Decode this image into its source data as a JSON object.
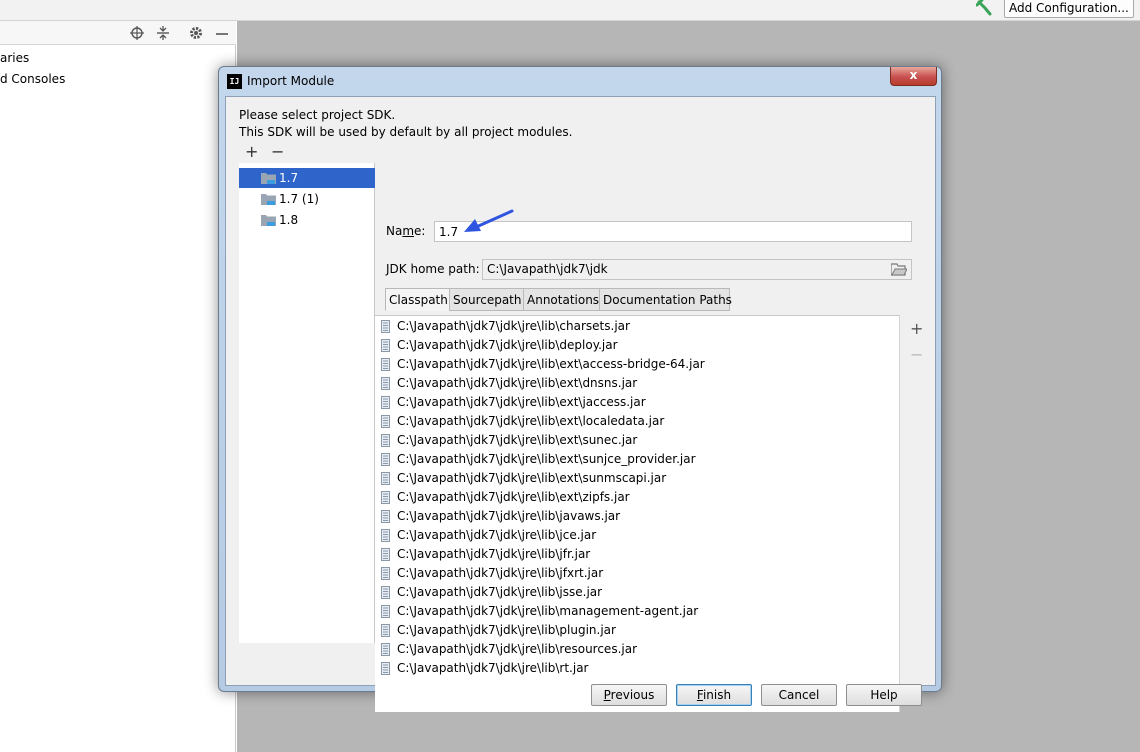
{
  "toolbar": {
    "add_configuration_label": "Add Configuration..."
  },
  "project_panel": {
    "items": [
      "aries",
      "d Consoles"
    ]
  },
  "dialog": {
    "title": "Import Module",
    "close_label": "x",
    "instructions": [
      "Please select project SDK.",
      "This SDK will be used by default by all project modules."
    ],
    "sdk_list": {
      "add_label": "+",
      "remove_label": "−",
      "items": [
        {
          "label": "1.7",
          "selected": true
        },
        {
          "label": "1.7 (1)",
          "selected": false
        },
        {
          "label": "1.8",
          "selected": false
        }
      ]
    },
    "name_label_pre": "Na",
    "name_label_mnemonic": "m",
    "name_label_post": "e:",
    "name_value": "1.7",
    "jdk_home_label": "JDK home path:",
    "jdk_home_value": "C:\\Javapath\\jdk7\\jdk",
    "tabs": [
      {
        "label": "Classpath",
        "active": true
      },
      {
        "label": "Sourcepath",
        "active": false
      },
      {
        "label": "Annotations",
        "active": false
      },
      {
        "label": "Documentation Paths",
        "active": false
      }
    ],
    "classpath": [
      "C:\\Javapath\\jdk7\\jdk\\jre\\lib\\charsets.jar",
      "C:\\Javapath\\jdk7\\jdk\\jre\\lib\\deploy.jar",
      "C:\\Javapath\\jdk7\\jdk\\jre\\lib\\ext\\access-bridge-64.jar",
      "C:\\Javapath\\jdk7\\jdk\\jre\\lib\\ext\\dnsns.jar",
      "C:\\Javapath\\jdk7\\jdk\\jre\\lib\\ext\\jaccess.jar",
      "C:\\Javapath\\jdk7\\jdk\\jre\\lib\\ext\\localedata.jar",
      "C:\\Javapath\\jdk7\\jdk\\jre\\lib\\ext\\sunec.jar",
      "C:\\Javapath\\jdk7\\jdk\\jre\\lib\\ext\\sunjce_provider.jar",
      "C:\\Javapath\\jdk7\\jdk\\jre\\lib\\ext\\sunmscapi.jar",
      "C:\\Javapath\\jdk7\\jdk\\jre\\lib\\ext\\zipfs.jar",
      "C:\\Javapath\\jdk7\\jdk\\jre\\lib\\javaws.jar",
      "C:\\Javapath\\jdk7\\jdk\\jre\\lib\\jce.jar",
      "C:\\Javapath\\jdk7\\jdk\\jre\\lib\\jfr.jar",
      "C:\\Javapath\\jdk7\\jdk\\jre\\lib\\jfxrt.jar",
      "C:\\Javapath\\jdk7\\jdk\\jre\\lib\\jsse.jar",
      "C:\\Javapath\\jdk7\\jdk\\jre\\lib\\management-agent.jar",
      "C:\\Javapath\\jdk7\\jdk\\jre\\lib\\plugin.jar",
      "C:\\Javapath\\jdk7\\jdk\\jre\\lib\\resources.jar",
      "C:\\Javapath\\jdk7\\jdk\\jre\\lib\\rt.jar"
    ],
    "classpath_add_label": "+",
    "classpath_remove_label": "−",
    "buttons": {
      "previous": {
        "mnemonic": "P",
        "rest": "revious"
      },
      "finish": {
        "mnemonic": "F",
        "rest": "inish"
      },
      "cancel": "Cancel",
      "help": "Help"
    }
  },
  "colors": {
    "selection": "#2f65ca",
    "arrow": "#2f55e0",
    "ide_background": "#b6b6b6"
  }
}
